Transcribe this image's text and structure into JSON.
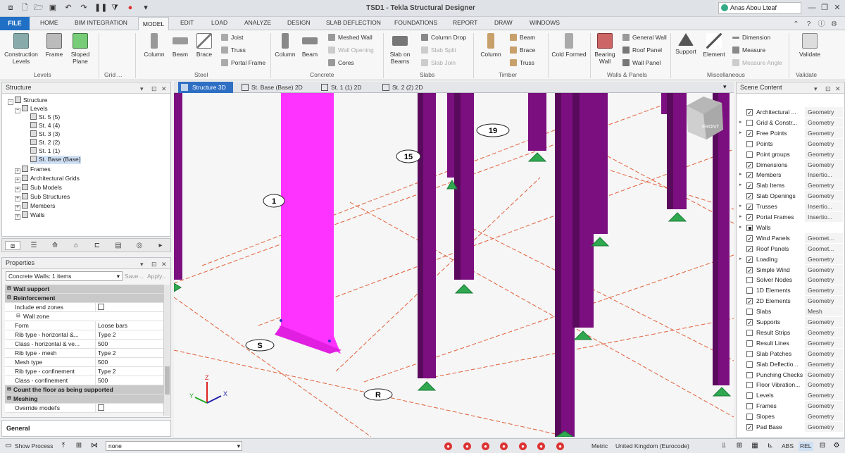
{
  "app": {
    "title": "TSD1 - Tekla Structural Designer",
    "user": "Anas Abou Lteaf"
  },
  "menu_tabs": [
    "FILE",
    "HOME",
    "BIM INTEGRATION",
    "MODEL",
    "EDIT",
    "LOAD",
    "ANALYZE",
    "DESIGN",
    "SLAB DEFLECTION",
    "FOUNDATIONS",
    "REPORT",
    "DRAW",
    "WINDOWS"
  ],
  "ribbon": {
    "groups": [
      "Levels",
      "Grid ...",
      "Steel",
      "Concrete",
      "Slabs",
      "Timber",
      "Walls & Panels",
      "Miscellaneous",
      "Validate"
    ],
    "buttons": {
      "construction_levels": "Construction Levels",
      "frame": "Frame",
      "sloped_plane": "Sloped Plane",
      "steel_column": "Column",
      "steel_beam": "Beam",
      "brace": "Brace",
      "joist": "Joist",
      "truss": "Truss",
      "portal_frame": "Portal Frame",
      "conc_column": "Column",
      "conc_beam": "Beam",
      "meshed_wall": "Meshed Wall",
      "wall_opening": "Wall Opening",
      "cores": "Cores",
      "slab_on_beams": "Slab on Beams",
      "column_drop": "Column Drop",
      "slab_split": "Slab Split",
      "slab_join": "Slab Join",
      "timber_column": "Column",
      "timber_beam": "Beam",
      "timber_brace": "Brace",
      "timber_truss": "Truss",
      "cold_formed": "Cold Formed",
      "bearing_wall": "Bearing Wall",
      "general_wall": "General Wall",
      "roof_panel": "Roof Panel",
      "wall_panel": "Wall Panel",
      "support": "Support",
      "element": "Element",
      "dimension": "Dimension",
      "measure": "Measure",
      "measure_angle": "Measure Angle",
      "validate": "Validate"
    }
  },
  "structure_panel": {
    "title": "Structure",
    "tree": [
      {
        "label": "Structure",
        "level": 0
      },
      {
        "label": "Levels",
        "level": 1
      },
      {
        "label": "St. 5 (5)",
        "level": 2
      },
      {
        "label": "St. 4 (4)",
        "level": 2
      },
      {
        "label": "St. 3 (3)",
        "level": 2
      },
      {
        "label": "St. 2 (2)",
        "level": 2
      },
      {
        "label": "St. 1 (1)",
        "level": 2
      },
      {
        "label": "St. Base (Base)",
        "level": 2
      },
      {
        "label": "Frames",
        "level": 1
      },
      {
        "label": "Architectural Grids",
        "level": 1
      },
      {
        "label": "Sub Models",
        "level": 1
      },
      {
        "label": "Sub Structures",
        "level": 1
      },
      {
        "label": "Members",
        "level": 1
      },
      {
        "label": "Walls",
        "level": 1
      }
    ]
  },
  "properties_panel": {
    "title": "Properties",
    "selection": "Concrete Walls: 1 items",
    "save": "Save...",
    "apply": "Apply...",
    "rows": [
      {
        "key": "Wall support",
        "value": "",
        "type": "section"
      },
      {
        "key": "Reinforcement",
        "value": "",
        "type": "section"
      },
      {
        "key": "Include end zones",
        "value": "",
        "type": "check"
      },
      {
        "key": "Wall zone",
        "value": "",
        "type": "sub"
      },
      {
        "key": "Form",
        "value": "Loose bars",
        "type": "row"
      },
      {
        "key": "Rib type - horizontal &...",
        "value": "Type 2",
        "type": "row"
      },
      {
        "key": "Class - horizontal & ve...",
        "value": "500",
        "type": "row"
      },
      {
        "key": "Rib type - mesh",
        "value": "Type 2",
        "type": "row"
      },
      {
        "key": "Mesh type",
        "value": "500",
        "type": "row"
      },
      {
        "key": "Rib type - confinement",
        "value": "Type 2",
        "type": "row"
      },
      {
        "key": "Class - confinement",
        "value": "500",
        "type": "row"
      },
      {
        "key": "Count the floor as being supported",
        "value": "",
        "type": "section"
      },
      {
        "key": "Meshing",
        "value": "",
        "type": "section"
      },
      {
        "key": "Override model's",
        "value": "",
        "type": "check"
      }
    ],
    "footer": "General"
  },
  "view_tabs": [
    "Structure 3D",
    "St. Base (Base) 2D",
    "St. 1 (1) 2D",
    "St. 2 (2) 2D"
  ],
  "viewport": {
    "grid_labels": [
      "19",
      "15",
      "1",
      "S",
      "R"
    ],
    "view_cube_label": "FRONT",
    "axes": {
      "x": "X",
      "y": "Y",
      "z": "Z"
    }
  },
  "scene_content": {
    "title": "Scene Content",
    "items": [
      {
        "name": "Architectural ...",
        "type": "Geometry",
        "checked": true,
        "arrow": false
      },
      {
        "name": "Grid & Constr...",
        "type": "Geometry",
        "checked": false,
        "arrow": true
      },
      {
        "name": "Free Points",
        "type": "Geometry",
        "checked": true,
        "arrow": true
      },
      {
        "name": "Points",
        "type": "Geometry",
        "checked": false,
        "arrow": false
      },
      {
        "name": "Point groups",
        "type": "Geometry",
        "checked": false,
        "arrow": false
      },
      {
        "name": "Dimensions",
        "type": "Geometry",
        "checked": true,
        "arrow": false
      },
      {
        "name": "Members",
        "type": "Insertio...",
        "checked": true,
        "arrow": true
      },
      {
        "name": "Slab Items",
        "type": "Geometry",
        "checked": true,
        "arrow": true
      },
      {
        "name": "Slab Openings",
        "type": "Geometry",
        "checked": true,
        "arrow": false
      },
      {
        "name": "Trusses",
        "type": "Insertio...",
        "checked": true,
        "arrow": true
      },
      {
        "name": "Portal Frames",
        "type": "Insertio...",
        "checked": true,
        "arrow": true
      },
      {
        "name": "Walls",
        "type": "",
        "checked": "partial",
        "arrow": true
      },
      {
        "name": "Wind Panels",
        "type": "Geomet...",
        "checked": true,
        "arrow": false
      },
      {
        "name": "Roof Panels",
        "type": "Geomet...",
        "checked": true,
        "arrow": false
      },
      {
        "name": "Loading",
        "type": "Geometry",
        "checked": true,
        "arrow": true
      },
      {
        "name": "Simple Wind",
        "type": "Geometry",
        "checked": true,
        "arrow": false
      },
      {
        "name": "Solver Nodes",
        "type": "Geometry",
        "checked": false,
        "arrow": false
      },
      {
        "name": "1D Elements",
        "type": "Geometry",
        "checked": false,
        "arrow": false
      },
      {
        "name": "2D Elements",
        "type": "Geometry",
        "checked": true,
        "arrow": false
      },
      {
        "name": "Slabs",
        "type": "Mesh",
        "checked": false,
        "arrow": false
      },
      {
        "name": "Supports",
        "type": "Geometry",
        "checked": true,
        "arrow": false
      },
      {
        "name": "Result Strips",
        "type": "Geometry",
        "checked": false,
        "arrow": false
      },
      {
        "name": "Result Lines",
        "type": "Geometry",
        "checked": false,
        "arrow": false
      },
      {
        "name": "Slab Patches",
        "type": "Geometry",
        "checked": false,
        "arrow": false
      },
      {
        "name": "Slab Deflectio...",
        "type": "Geometry",
        "checked": false,
        "arrow": false
      },
      {
        "name": "Punching Checks",
        "type": "Geometry",
        "checked": false,
        "arrow": false
      },
      {
        "name": "Floor Vibration...",
        "type": "Geometry",
        "checked": false,
        "arrow": false
      },
      {
        "name": "Levels",
        "type": "Geometry",
        "checked": false,
        "arrow": false
      },
      {
        "name": "Frames",
        "type": "Geometry",
        "checked": false,
        "arrow": false
      },
      {
        "name": "Slopes",
        "type": "Geometry",
        "checked": false,
        "arrow": false
      },
      {
        "name": "Pad Base",
        "type": "Geometry",
        "checked": true,
        "arrow": false
      }
    ]
  },
  "status_bar": {
    "show_process": "Show Process",
    "filter_value": "none",
    "units": "Metric",
    "locale": "United Kingdom (Eurocode)",
    "abs": "ABS",
    "rel": "REL"
  },
  "colors": {
    "accent": "#1f6fc5",
    "column": "#7b0f7f",
    "selected_wall": "#ff33ff",
    "support": "#2fa84f",
    "grid_line": "#e0603a"
  }
}
